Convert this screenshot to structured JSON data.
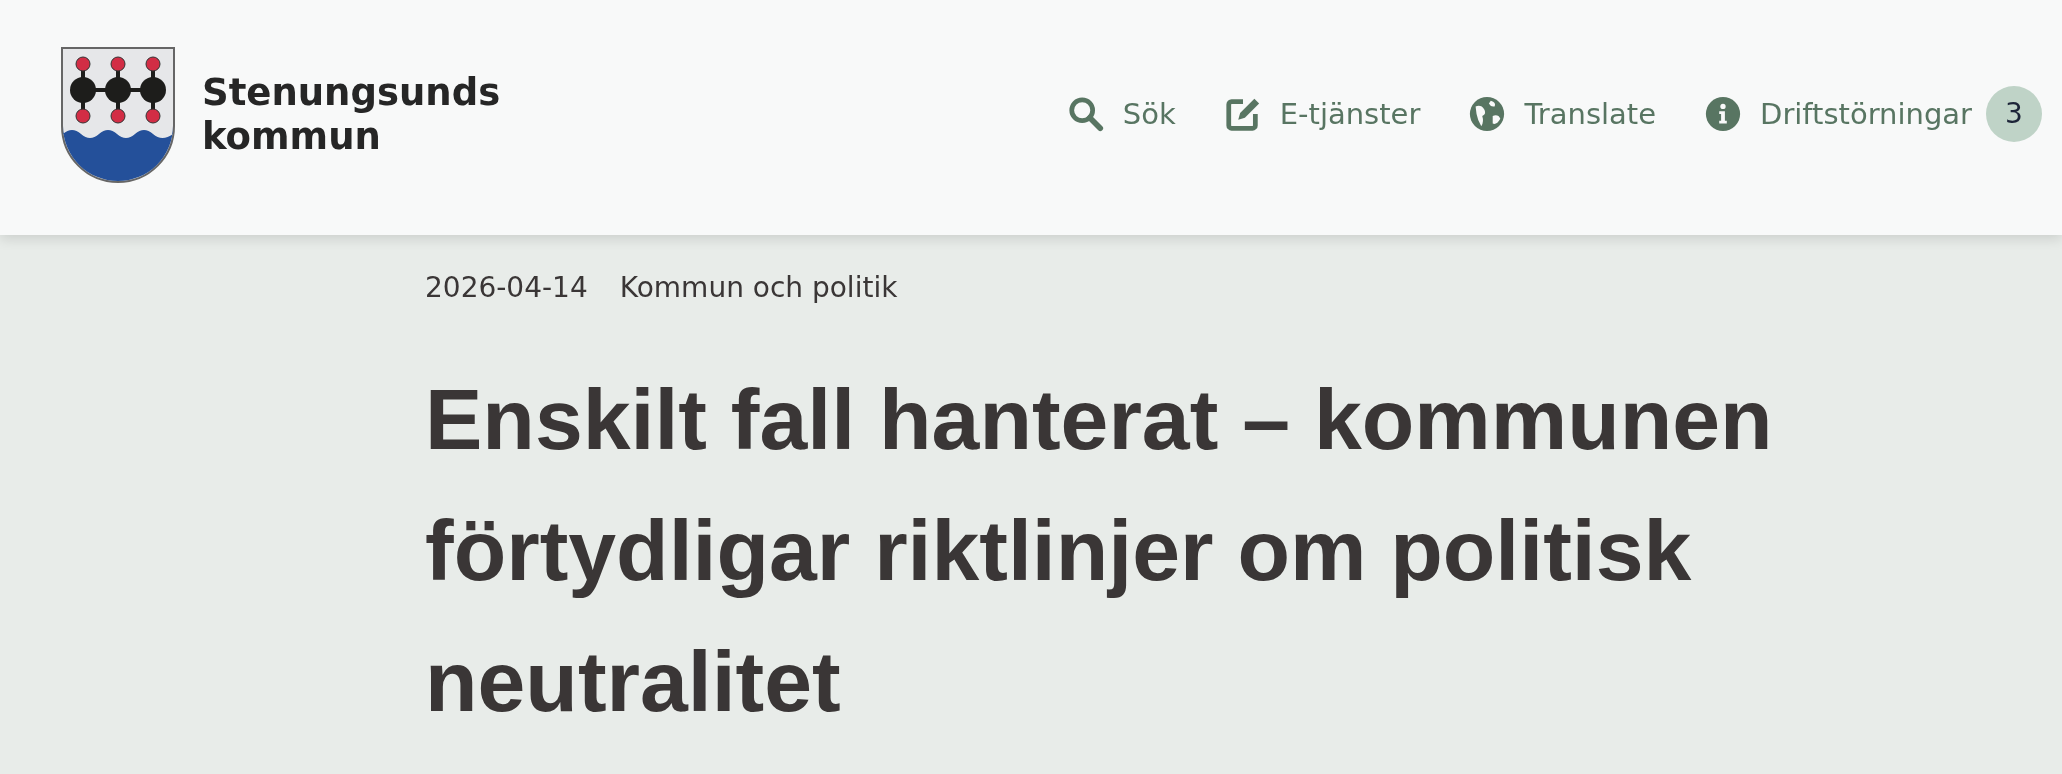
{
  "header": {
    "logo_text": [
      "Stenungsunds",
      "kommun"
    ],
    "nav": [
      {
        "kind": "search",
        "label": "Sök"
      },
      {
        "kind": "edit",
        "label": "E-tjänster"
      },
      {
        "kind": "globe",
        "label": "Translate"
      },
      {
        "kind": "info",
        "label": "Driftstörningar",
        "badge": "3"
      }
    ]
  },
  "article": {
    "date": "2026-04-14",
    "category": "Kommun och politik",
    "title": "Enskilt fall hanterat – kommunen förtydligar riktlinjer om politisk neutralitet"
  }
}
